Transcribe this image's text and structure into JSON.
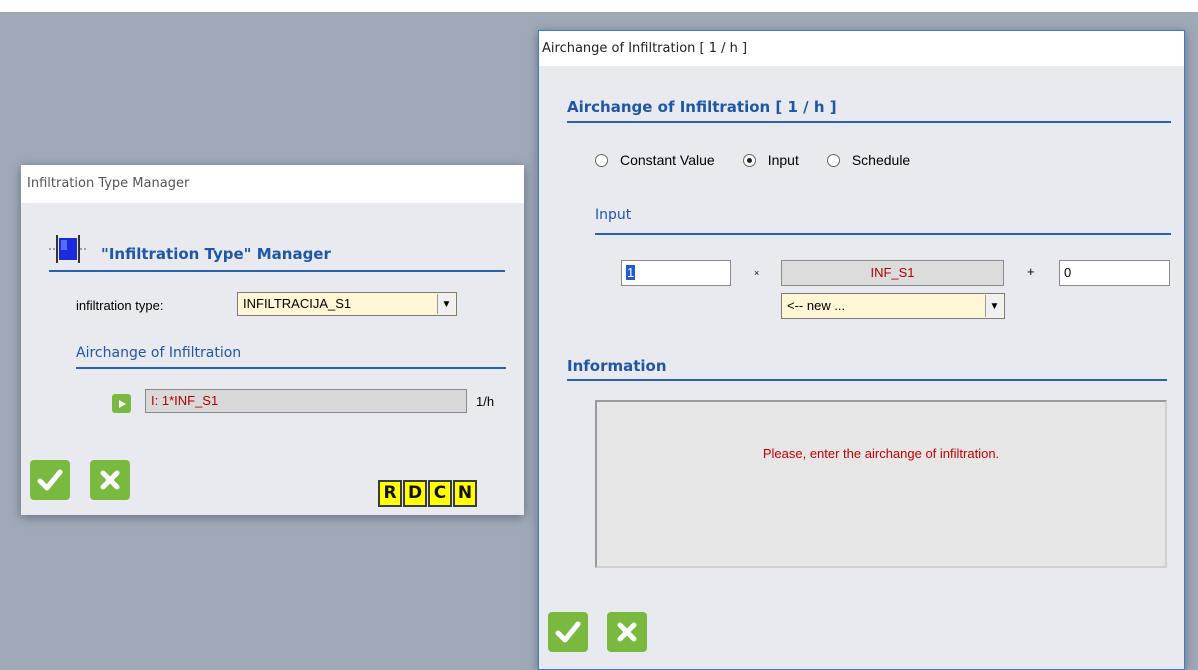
{
  "left_window": {
    "title": "Infiltration Type Manager",
    "header": "\"Infiltration Type\" Manager",
    "type_label": "infiltration type:",
    "type_value": "INFILTRACIJA_S1",
    "section": "Airchange of Infiltration",
    "expression": "I: 1*INF_S1",
    "unit": "1/h",
    "buttons": [
      "R",
      "D",
      "C",
      "N"
    ]
  },
  "right_window": {
    "title": "Airchange of Infiltration  [ 1 / h ]",
    "header": "Airchange of Infiltration  [ 1 / h ]",
    "radios": [
      {
        "label": "Constant Value",
        "selected": false
      },
      {
        "label": "Input",
        "selected": true
      },
      {
        "label": "Schedule",
        "selected": false
      }
    ],
    "input_section": "Input",
    "multiplier": "1",
    "times_sign": "×",
    "input_name": "INF_S1",
    "plus_sign": "+",
    "offset": "0",
    "input_select": "<-- new ...",
    "information_header": "Information",
    "information_text": "Please, enter the airchange of infiltration."
  },
  "colors": {
    "accent_blue": "#1f56a6",
    "ok_green": "#7ab93f",
    "error_red": "#c00000",
    "highlight_yellow": "#ffff00"
  }
}
